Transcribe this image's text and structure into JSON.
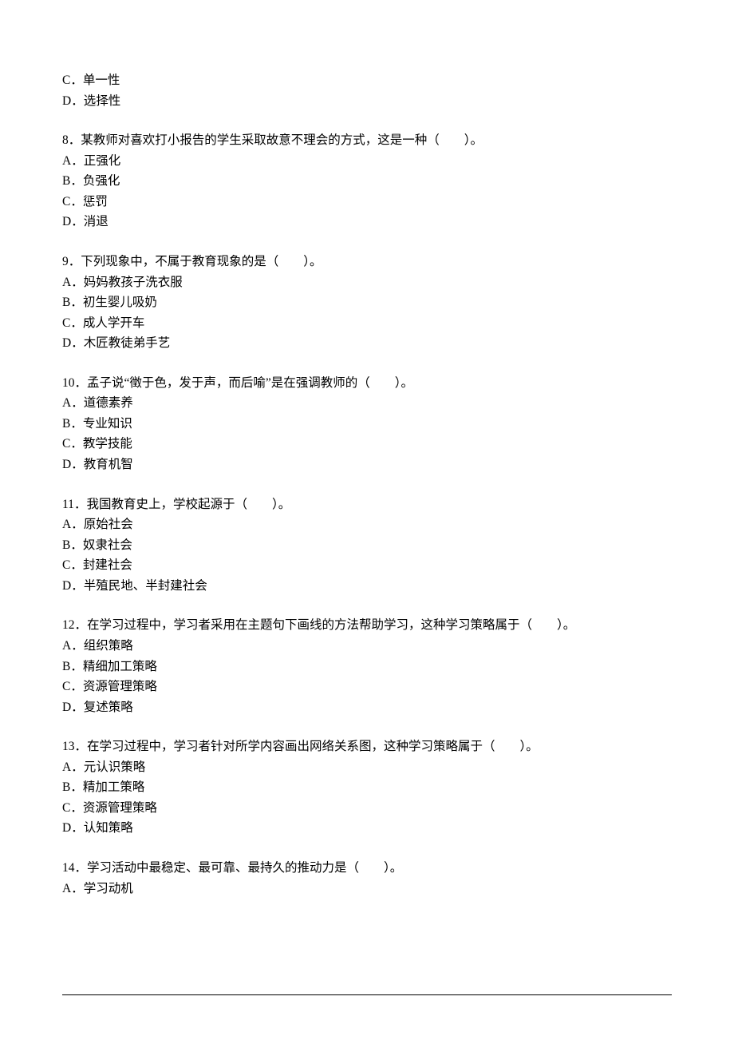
{
  "prefixOptions": [
    {
      "letter": "C",
      "text": "单一性"
    },
    {
      "letter": "D",
      "text": "选择性"
    }
  ],
  "questions": [
    {
      "number": "8",
      "stem": "某教师对喜欢打小报告的学生采取故意不理会的方式，这是一种（　　）。",
      "options": [
        {
          "letter": "A",
          "text": "正强化"
        },
        {
          "letter": "B",
          "text": "负强化"
        },
        {
          "letter": "C",
          "text": "惩罚"
        },
        {
          "letter": "D",
          "text": "消退"
        }
      ]
    },
    {
      "number": "9",
      "stem": "下列现象中，不属于教育现象的是（　　）。",
      "options": [
        {
          "letter": "A",
          "text": "妈妈教孩子洗衣服"
        },
        {
          "letter": "B",
          "text": "初生婴儿吸奶"
        },
        {
          "letter": "C",
          "text": "成人学开车"
        },
        {
          "letter": "D",
          "text": "木匠教徒弟手艺"
        }
      ]
    },
    {
      "number": "10",
      "stem": "孟子说“徵于色，发于声，而后喻”是在强调教师的（　　）。",
      "options": [
        {
          "letter": "A",
          "text": "道德素养"
        },
        {
          "letter": "B",
          "text": "专业知识"
        },
        {
          "letter": "C",
          "text": "教学技能"
        },
        {
          "letter": "D",
          "text": "教育机智"
        }
      ]
    },
    {
      "number": "11",
      "stem": "我国教育史上，学校起源于（　　）。",
      "options": [
        {
          "letter": "A",
          "text": "原始社会"
        },
        {
          "letter": "B",
          "text": "奴隶社会"
        },
        {
          "letter": "C",
          "text": "封建社会"
        },
        {
          "letter": "D",
          "text": "半殖民地、半封建社会"
        }
      ]
    },
    {
      "number": "12",
      "stem": "在学习过程中，学习者采用在主题句下画线的方法帮助学习，这种学习策略属于（　　）。",
      "options": [
        {
          "letter": "A",
          "text": "组织策略"
        },
        {
          "letter": "B",
          "text": "精细加工策略"
        },
        {
          "letter": "C",
          "text": "资源管理策略"
        },
        {
          "letter": "D",
          "text": "复述策略"
        }
      ]
    },
    {
      "number": "13",
      "stem": "在学习过程中，学习者针对所学内容画出网络关系图，这种学习策略属于（　　）。",
      "options": [
        {
          "letter": "A",
          "text": "元认识策略"
        },
        {
          "letter": "B",
          "text": "精加工策略"
        },
        {
          "letter": "C",
          "text": "资源管理策略"
        },
        {
          "letter": "D",
          "text": "认知策略"
        }
      ]
    },
    {
      "number": "14",
      "stem": "学习活动中最稳定、最可靠、最持久的推动力是（　　）。",
      "options": [
        {
          "letter": "A",
          "text": "学习动机"
        }
      ]
    }
  ]
}
